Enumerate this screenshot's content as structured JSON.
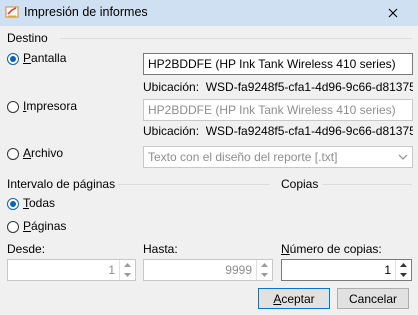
{
  "window": {
    "title": "Impresión de informes"
  },
  "destino": {
    "label": "Destino",
    "pantalla": {
      "prefix": "",
      "mnemonic": "P",
      "rest": "antalla",
      "selected": true,
      "printer": "HP2BDDFE (HP Ink Tank Wireless 410 series)",
      "ubicacion_label": "Ubicación:",
      "ubicacion_value": "WSD-fa9248f5-cfa1-4d96-9c66-d81375"
    },
    "impresora": {
      "prefix": "",
      "mnemonic": "I",
      "rest": "mpresora",
      "selected": false,
      "printer": "HP2BDDFE (HP Ink Tank Wireless 410 series)",
      "ubicacion_label": "Ubicación:",
      "ubicacion_value": "WSD-fa9248f5-cfa1-4d96-9c66-d81375"
    },
    "archivo": {
      "prefix": "",
      "mnemonic": "A",
      "rest": "rchivo",
      "selected": false,
      "format": "Texto con el diseño del reporte [.txt]"
    }
  },
  "intervalo": {
    "label": "Intervalo de páginas",
    "todas": {
      "mnemonic": "T",
      "rest": "odas",
      "selected": true
    },
    "paginas": {
      "mnemonic": "P",
      "rest": "áginas",
      "selected": false
    },
    "desde_label": "Desde:",
    "desde_value": "1",
    "hasta_label": "Hasta:",
    "hasta_value": "9999"
  },
  "copias": {
    "label": "Copias",
    "numero_mnemonic": "N",
    "numero_rest": "úmero de copias:",
    "value": "1"
  },
  "buttons": {
    "aceptar_mnemonic": "A",
    "aceptar_rest": "ceptar",
    "cancelar": "Cancelar"
  },
  "colors": {
    "accent": "#0a64ad",
    "titlebar": "#cfe0f2"
  }
}
